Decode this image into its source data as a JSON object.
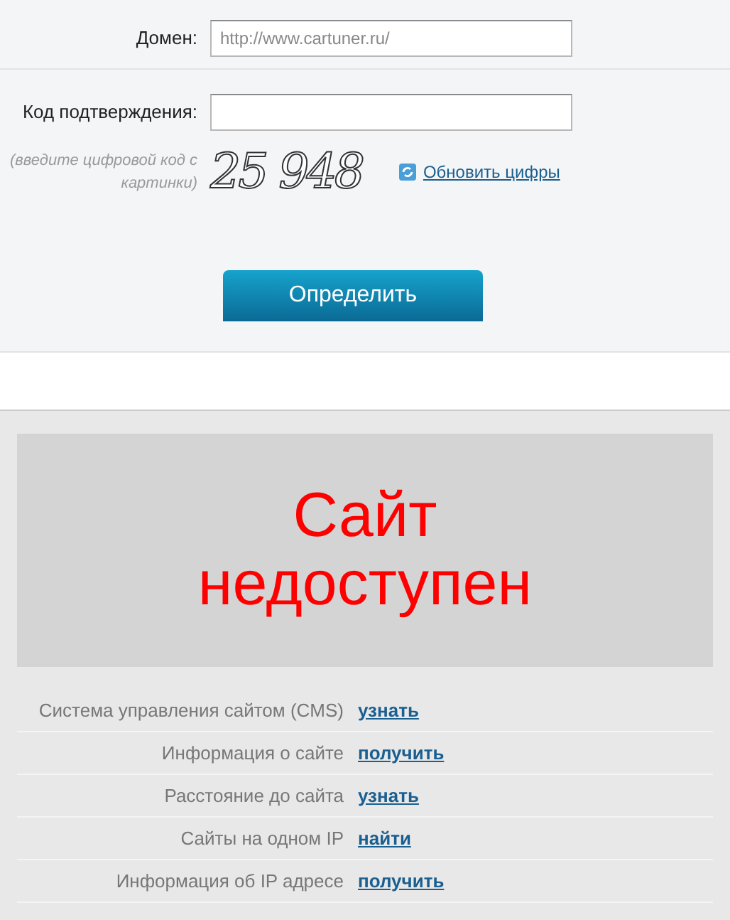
{
  "form": {
    "domain_label": "Домен:",
    "domain_value": "http://www.cartuner.ru/",
    "code_label": "Код подтверждения:",
    "code_hint": "(введите цифровой код с картинки)",
    "captcha": "25 948",
    "refresh_link": "Обновить цифры",
    "submit": "Определить"
  },
  "status": {
    "message": "Сайт недоступен"
  },
  "info_rows": [
    {
      "label": "Система управления сайтом (CMS)",
      "action": "узнать"
    },
    {
      "label": "Информация о сайте",
      "action": "получить"
    },
    {
      "label": "Расстояние до сайта",
      "action": "узнать"
    },
    {
      "label": "Сайты на одном IP",
      "action": "найти"
    },
    {
      "label": "Информация об IP адресе",
      "action": "получить"
    }
  ]
}
